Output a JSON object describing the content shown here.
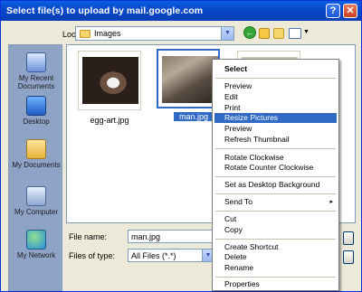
{
  "window": {
    "title": "Select file(s) to upload by mail.google.com",
    "help_glyph": "?",
    "close_glyph": "✕"
  },
  "lookin": {
    "label": "Look in:",
    "value": "Images"
  },
  "places": [
    {
      "label": "My Recent Documents",
      "icon": "recent-documents-icon"
    },
    {
      "label": "Desktop",
      "icon": "desktop-icon"
    },
    {
      "label": "My Documents",
      "icon": "my-documents-icon"
    },
    {
      "label": "My Computer",
      "icon": "my-computer-icon"
    },
    {
      "label": "My Network",
      "icon": "my-network-icon"
    }
  ],
  "files": [
    {
      "name": "egg-art.jpg",
      "selected": false
    },
    {
      "name": "man.jpg",
      "selected": true
    },
    {
      "name": "",
      "selected": false
    }
  ],
  "filename": {
    "label": "File name:",
    "value": "man.jpg"
  },
  "filetype": {
    "label": "Files of type:",
    "value": "All Files (*.*)"
  },
  "context_menu": {
    "items": [
      {
        "label": "Select",
        "bold": true
      },
      {
        "label": "Preview"
      },
      {
        "label": "Edit"
      },
      {
        "label": "Print"
      },
      {
        "label": "Resize Pictures",
        "highlighted": true
      },
      {
        "label": "Preview"
      },
      {
        "label": "Refresh Thumbnail"
      },
      {
        "label": "Rotate Clockwise"
      },
      {
        "label": "Rotate Counter Clockwise"
      },
      {
        "label": "Set as Desktop Background"
      },
      {
        "label": "Send To",
        "submenu": "▸"
      },
      {
        "label": "Cut"
      },
      {
        "label": "Copy"
      },
      {
        "label": "Create Shortcut"
      },
      {
        "label": "Delete"
      },
      {
        "label": "Rename"
      },
      {
        "label": "Properties"
      }
    ]
  },
  "colors": {
    "titlebar": "#0a5fe0",
    "selection": "#316ac5"
  }
}
